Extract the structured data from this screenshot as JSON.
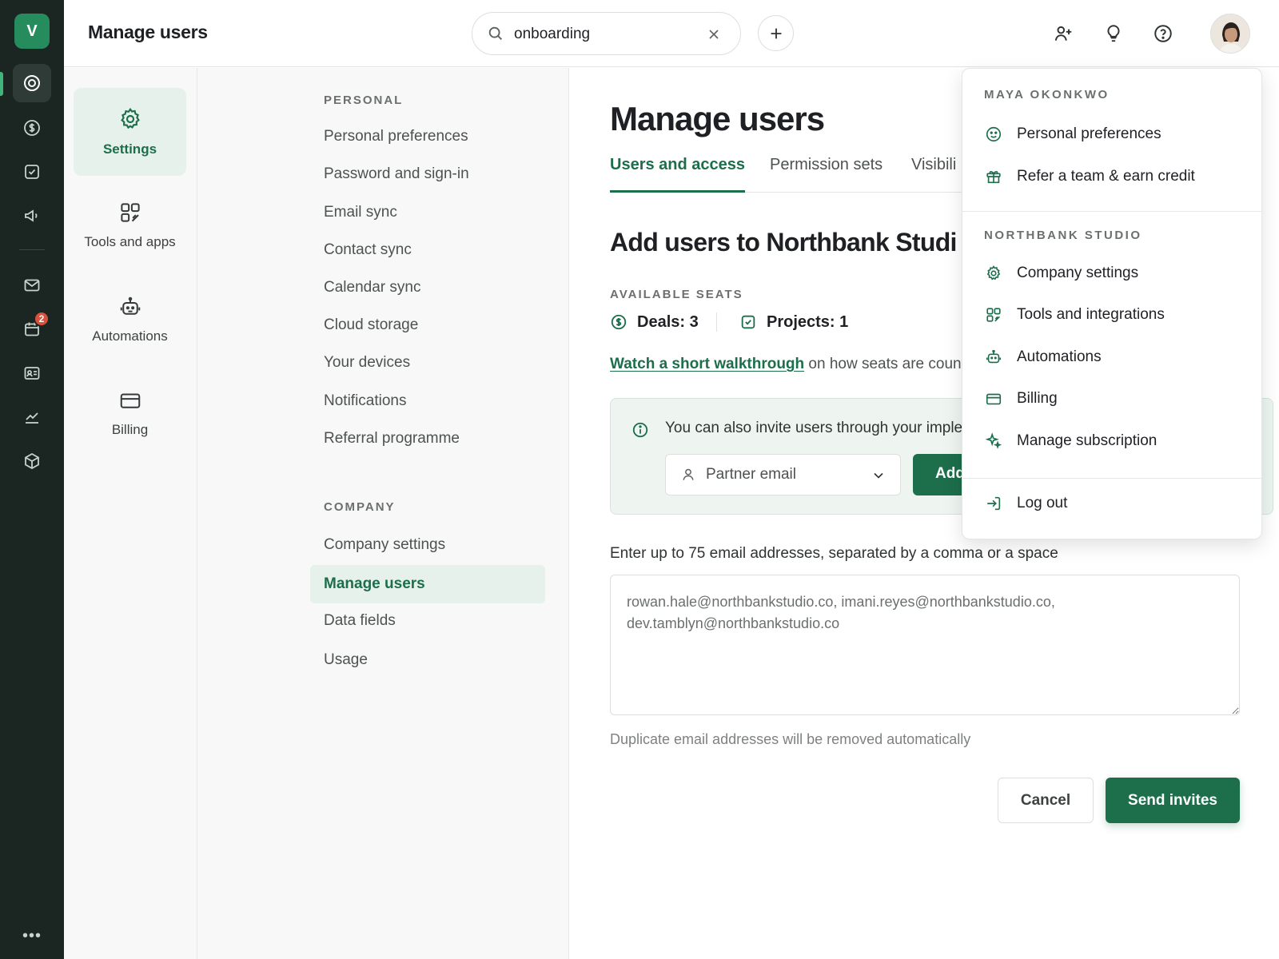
{
  "rail": {
    "logo": "V",
    "badge": "2",
    "more": "•••",
    "icons": [
      "target-icon",
      "dollar-icon",
      "check-square-icon",
      "megaphone-icon",
      "mail-icon",
      "calendar-icon",
      "contact-card-icon",
      "chart-icon",
      "box-icon"
    ]
  },
  "header": {
    "title": "Manage users",
    "search_value": "onboarding"
  },
  "categories": [
    {
      "label": "Settings"
    },
    {
      "label": "Tools and apps"
    },
    {
      "label": "Automations"
    },
    {
      "label": "Billing"
    }
  ],
  "subnav": {
    "personal_label": "PERSONAL",
    "personal_items": [
      "Personal preferences",
      "Password and sign-in",
      "Email sync",
      "Contact sync",
      "Calendar sync",
      "Cloud storage",
      "Your devices",
      "Notifications",
      "Referral programme"
    ],
    "company_label": "COMPANY",
    "company_items": [
      "Company settings",
      "Manage users",
      "Data fields",
      "Usage"
    ],
    "active_item": "Manage users"
  },
  "main": {
    "title": "Manage users",
    "tabs": [
      "Users and access",
      "Permission sets",
      "Visibili"
    ],
    "subtitle": "Add users to Northbank Studi",
    "seats_label": "AVAILABLE SEATS",
    "seat_deals": "Deals: 3",
    "seat_projects": "Projects: 1",
    "walk_link": "Watch a short walkthrough",
    "walk_rest": " on how seats are count",
    "info_text": "You can also invite users through your imple",
    "partner_placeholder": "Partner email",
    "add_label": "Add",
    "email_hint": "Enter up to 75 email addresses, separated by a comma or a space",
    "email_value": "rowan.hale@northbankstudio.co, imani.reyes@northbankstudio.co,\ndev.tamblyn@northbankstudio.co",
    "dup_hint": "Duplicate email addresses will be removed automatically",
    "cancel_label": "Cancel",
    "send_label": "Send invites"
  },
  "menu": {
    "user_label": "MAYA OKONKWO",
    "user_items": [
      {
        "label": "Personal preferences",
        "icon": "smile-icon"
      },
      {
        "label": "Refer a team & earn credit",
        "icon": "gift-icon"
      }
    ],
    "company_label": "NORTHBANK STUDIO",
    "company_items": [
      {
        "label": "Company settings",
        "icon": "gear-icon"
      },
      {
        "label": "Tools and integrations",
        "icon": "apps-icon"
      },
      {
        "label": "Automations",
        "icon": "robot-icon"
      },
      {
        "label": "Billing",
        "icon": "card-icon"
      },
      {
        "label": "Manage subscription",
        "icon": "sparkle-icon"
      }
    ],
    "logout_label": "Log out"
  },
  "colors": {
    "accent": "#1d6e4b",
    "rail_bg": "#1b2622",
    "badge": "#d9513d"
  }
}
